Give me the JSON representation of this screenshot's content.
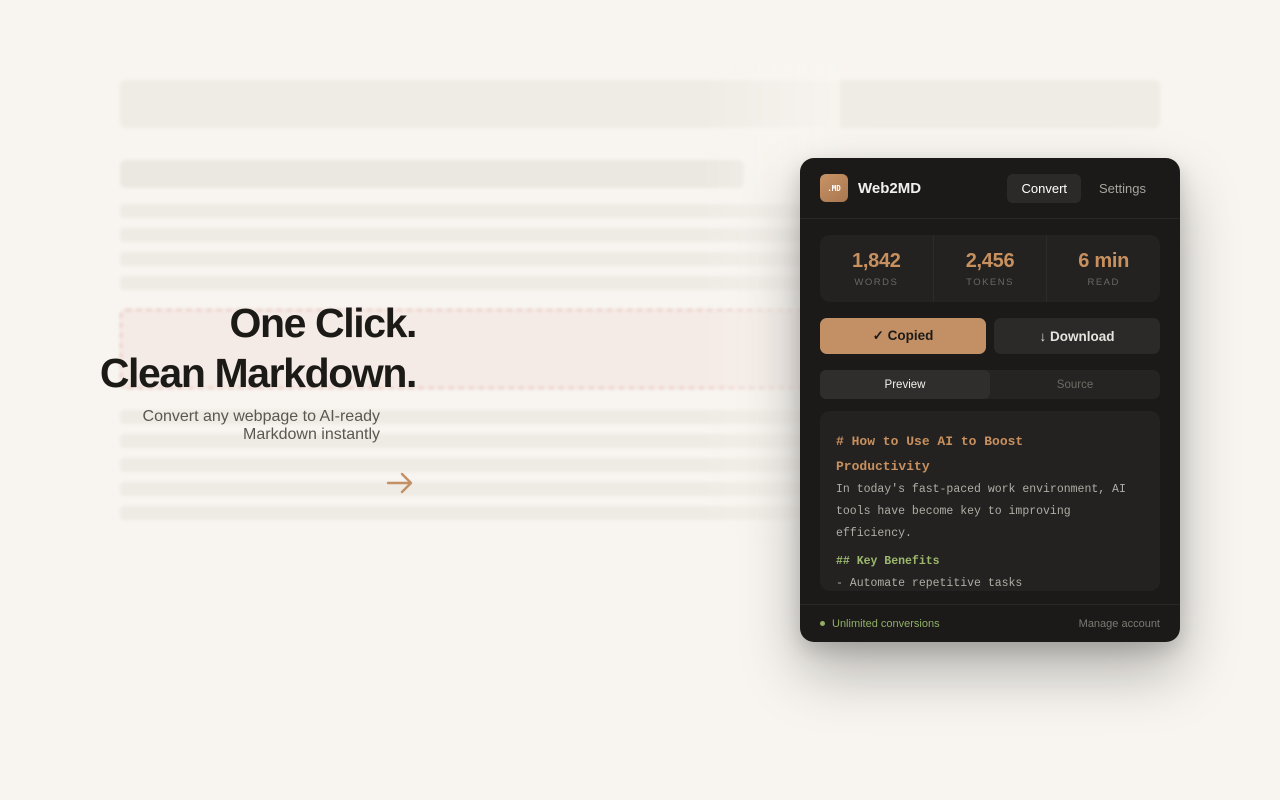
{
  "hero": {
    "title_line1": "One Click.",
    "title_line2": "Clean Markdown.",
    "subtitle_line1": "Convert any webpage to AI-ready",
    "subtitle_line2": "Markdown instantly"
  },
  "panel": {
    "logo_text": ".MD",
    "app_name": "Web2MD",
    "nav": {
      "convert": "Convert",
      "settings": "Settings"
    },
    "stats": [
      {
        "value": "1,842",
        "label": "WORDS"
      },
      {
        "value": "2,456",
        "label": "TOKENS"
      },
      {
        "value": "6 min",
        "label": "READ"
      }
    ],
    "buttons": {
      "copied": "✓ Copied",
      "download": "↓ Download"
    },
    "view_tabs": {
      "preview": "Preview",
      "source": "Source"
    },
    "preview": {
      "h1_line1": "# How to Use AI to Boost",
      "h1_line2": "Productivity",
      "p_line1": "In today's fast-paced work environment, AI",
      "p_line2": "tools have become key to improving",
      "p_line3": "efficiency.",
      "h2": "## Key Benefits",
      "li1": "- Automate repetitive tasks"
    },
    "footer": {
      "status": "Unlimited conversions",
      "manage": "Manage account"
    }
  },
  "colors": {
    "accent": "#c39065",
    "background": "#f8f5f0",
    "panel_bg": "#1b1a19",
    "status_green": "#8fae66"
  },
  "icons": {
    "arrow": "arrow-right-icon"
  }
}
